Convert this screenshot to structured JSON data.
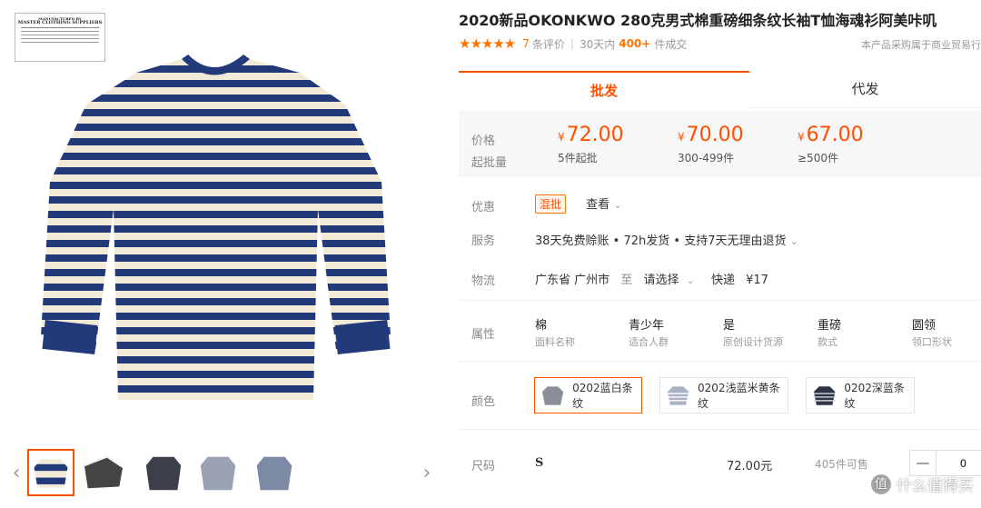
{
  "hang_tag": {
    "line1": "MANUFACTURED BY",
    "line2": "MASTER CLOTHING SUPPLIERS"
  },
  "product": {
    "title": "2020新品OKONKWO 280克男式棉重磅细条纹长袖T恤海魂衫阿美咔叽",
    "stars": "★★★★★",
    "review_count": "7",
    "review_suffix": "条评价",
    "sold_prefix": "30天内",
    "sold_count": "400+",
    "sold_suffix": "件成交",
    "notice": "本产品采购属于商业贸易行"
  },
  "tabs": {
    "wholesale": "批发",
    "dropship": "代发"
  },
  "price": {
    "price_label": "价格",
    "moq_label": "起批量",
    "currency": "¥",
    "tiers": [
      {
        "price": "72.00",
        "moq": "5件起批"
      },
      {
        "price": "70.00",
        "moq": "300-499件"
      },
      {
        "price": "67.00",
        "moq": "≥500件"
      }
    ]
  },
  "promo": {
    "label": "优惠",
    "badge": "混批",
    "view": "查看"
  },
  "service": {
    "label": "服务",
    "text": "38天免费赊账 • 72h发货 • 支持7天无理由退货"
  },
  "logistics": {
    "label": "物流",
    "origin": "广东省 广州市",
    "to": "至",
    "dest": "请选择",
    "express": "快递",
    "fee": "¥17"
  },
  "attributes": {
    "label": "属性",
    "items": [
      {
        "value": "棉",
        "key": "面料名称"
      },
      {
        "value": "青少年",
        "key": "适合人群"
      },
      {
        "value": "是",
        "key": "原创设计货源"
      },
      {
        "value": "重磅",
        "key": "款式"
      },
      {
        "value": "圆领",
        "key": "领口形状"
      }
    ]
  },
  "colors": {
    "label": "颜色",
    "options": [
      {
        "name": "0202蓝白条纹"
      },
      {
        "name": "0202浅蓝米黄条纹"
      },
      {
        "name": "0202深蓝条纹"
      }
    ]
  },
  "size": {
    "label": "尺码",
    "value": "S",
    "price": "72.00元",
    "stock": "405件可售",
    "qty": "0",
    "minus": "—"
  },
  "watermark": {
    "logo": "值",
    "text": "什么值得买"
  },
  "theme": {
    "accent": "#ff5000",
    "star": "#ff7300",
    "stripe_navy": "#223a7a",
    "stripe_cream": "#f1ead6"
  }
}
